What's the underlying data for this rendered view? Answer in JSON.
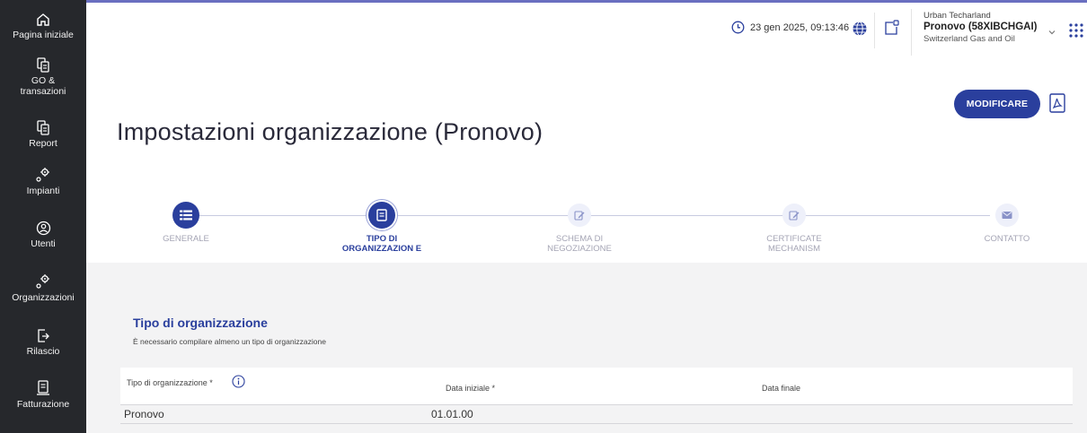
{
  "sidebar": {
    "items": [
      {
        "label": "Pagina iniziale",
        "icon": "home-icon"
      },
      {
        "label": "GO & transazioni",
        "icon": "documents-icon"
      },
      {
        "label": "Report",
        "icon": "report-icon"
      },
      {
        "label": "Impianti",
        "icon": "plant-gear-icon"
      },
      {
        "label": "Utenti",
        "icon": "user-circle-icon"
      },
      {
        "label": "Organizzazioni",
        "icon": "organization-gear-icon"
      },
      {
        "label": "Rilascio",
        "icon": "release-icon"
      },
      {
        "label": "Fatturazione",
        "icon": "invoice-icon"
      }
    ]
  },
  "header": {
    "datetime": "23 gen 2025, 09:13:46",
    "user": {
      "name": "Urban Techarland",
      "organization": "Pronovo (58XIBCHGAI)",
      "company": "Switzerland Gas and Oil"
    },
    "icons": [
      "clock-icon",
      "globe-icon",
      "switch-window-icon",
      "chevron-down-icon",
      "apps-grid-icon"
    ]
  },
  "page": {
    "title": "Impostazioni organizzazione (Pronovo)",
    "modify_label": "MODIFICARE"
  },
  "stepper": {
    "steps": [
      {
        "label": "GENERALE",
        "state": "done",
        "icon": "list-icon"
      },
      {
        "label": "TIPO DI ORGANIZZAZION E",
        "state": "current",
        "icon": "document-icon"
      },
      {
        "label": "SCHEMA DI NEGOZIAZIONE",
        "state": "pending",
        "icon": "edit-icon"
      },
      {
        "label": "CERTIFICATE MECHANISM",
        "state": "pending",
        "icon": "edit-icon"
      },
      {
        "label": "CONTATTO",
        "state": "pending",
        "icon": "mail-icon"
      }
    ]
  },
  "section": {
    "title": "Tipo di organizzazione",
    "note": "È necessario compilare almeno un tipo di organizzazione",
    "table": {
      "headers": [
        "Tipo di organizzazione *",
        "Data iniziale *",
        "Data finale"
      ],
      "rows": [
        [
          "Pronovo",
          "01.01.00",
          ""
        ]
      ]
    }
  },
  "colors": {
    "sidebar_bg": "#26282c",
    "accent": "#2a3f9d",
    "panel_bg": "#f3f3f4"
  }
}
